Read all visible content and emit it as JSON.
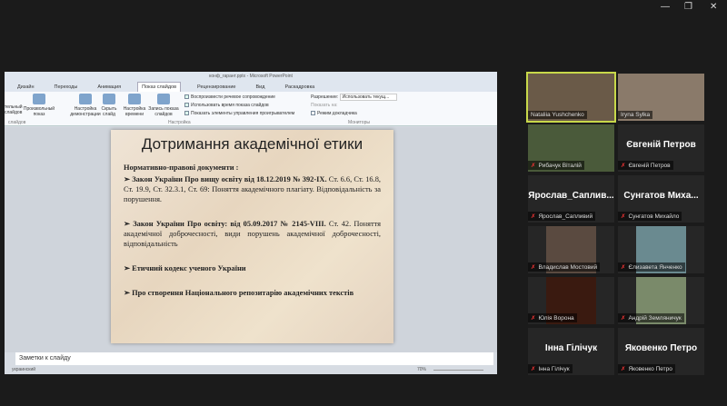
{
  "window_controls": [
    "—",
    "❐",
    "✕"
  ],
  "ppt": {
    "title": "конф_гарант.pptx - Microsoft PowerPoint",
    "tabs": [
      "Дизайн",
      "Переходы",
      "Анимация",
      "Показ слайдов",
      "Рецензирование",
      "Вид",
      "Раскадровка"
    ],
    "ribbon": {
      "buttons": [
        "тельный слайдов",
        "Произвольный показ",
        "Настройка демонстрации",
        "Скрыть слайд",
        "Настройка времени",
        "Запись показа слайдов"
      ],
      "checks": [
        "Воспроизвести речевое сопровождение",
        "Использовать время показа слайдов",
        "Показать элементы управления проигрывателем"
      ],
      "resolution_label": "Разрешение:",
      "resolution_value": "Использовать текущ...",
      "show_on": "Показать на:",
      "presenter": "Режим докладчика",
      "groups": [
        "слайдов",
        "Настройка",
        "Мониторы"
      ]
    },
    "slide": {
      "title": "Дотримання академічної етики",
      "subtitle": "Нормативно-правові документи :",
      "items": [
        {
          "bold": "➢ Закон України Про вищу освіту від 18.12.2019 № 392-IX.",
          "text": " Ст. 6.6, Ст. 16.8, Ст. 19.9, Ст. 32.3.1, Ст. 69: Поняття академічного плагіату. Відповідальність за порушення."
        },
        {
          "bold": "➢ Закон України Про освіту: від 05.09.2017 № 2145-VIII.",
          "text": " Ст. 42. Поняття академічної доброчесності, види порушень академічної доброчесності, відповідальність"
        },
        {
          "bold": "➢ Етичний кодекс ученого України",
          "text": ""
        },
        {
          "bold": "➢ Про створення Національного репозитарію академічних текстів",
          "text": ""
        }
      ]
    },
    "notes": "Заметки к слайду",
    "status_lang": "украинский",
    "zoom": "70%"
  },
  "participants": [
    {
      "name": "Nataliia Yushchenko",
      "video": true,
      "active": true
    },
    {
      "name": "Iryna Sylka",
      "video": true
    },
    {
      "name": "Рибачук Віталій",
      "video": true,
      "muted": true
    },
    {
      "name": "Євгеній Петров",
      "big": "Євгеній Петров",
      "muted": true
    },
    {
      "name": "Ярослав_Сапливий",
      "big": "Ярослав_Саплив...",
      "muted": true
    },
    {
      "name": "Сунгатов Михайло",
      "big": "Сунгатов Миха...",
      "muted": true
    },
    {
      "name": "Владислав Мостовий",
      "video": true,
      "muted": true
    },
    {
      "name": "Єлизавета Янченко",
      "video": true,
      "muted": true
    },
    {
      "name": "Юлія Ворона",
      "video": true,
      "muted": true
    },
    {
      "name": "Андрій Земляничук",
      "video": true,
      "muted": true
    },
    {
      "name": "Інна Гілічук",
      "big": "Інна Гілічук",
      "muted": true
    },
    {
      "name": "Яковенко Петро",
      "big": "Яковенко Петро",
      "muted": true
    }
  ]
}
